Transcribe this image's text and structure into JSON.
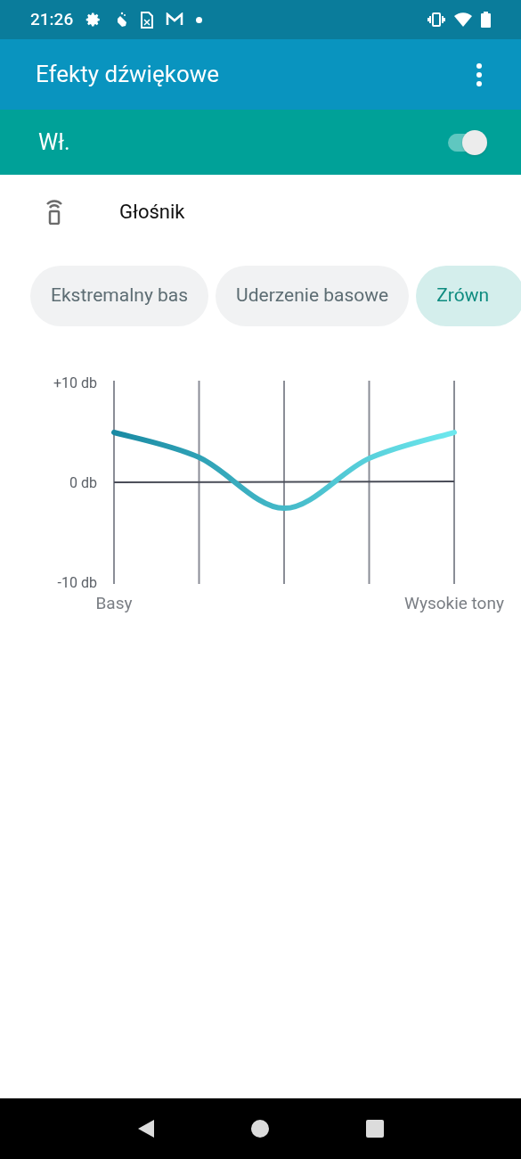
{
  "status_bar": {
    "time": "21:26"
  },
  "app_bar": {
    "title": "Efekty dźwiękowe"
  },
  "master_switch": {
    "label": "Wł.",
    "on": true
  },
  "output": {
    "label": "Głośnik"
  },
  "presets": [
    {
      "label": "Ekstremalny bas",
      "selected": false
    },
    {
      "label": "Uderzenie basowe",
      "selected": false
    },
    {
      "label": "Zrówn",
      "selected": true
    }
  ],
  "equalizer": {
    "chart_data": {
      "type": "line",
      "grid": true,
      "categories": [
        "Basy",
        null,
        null,
        null,
        "Wysokie tony"
      ],
      "series": [
        {
          "color": "#1a8aa3",
          "values": [
            5,
            2.5,
            -2.6,
            2.4,
            5
          ]
        }
      ],
      "ylim": [
        -10,
        10
      ],
      "yticks": [
        {
          "value": 10,
          "label": "+10 db"
        },
        {
          "value": 0,
          "label": "0 db"
        },
        {
          "value": -10,
          "label": "-10 db"
        }
      ]
    }
  }
}
